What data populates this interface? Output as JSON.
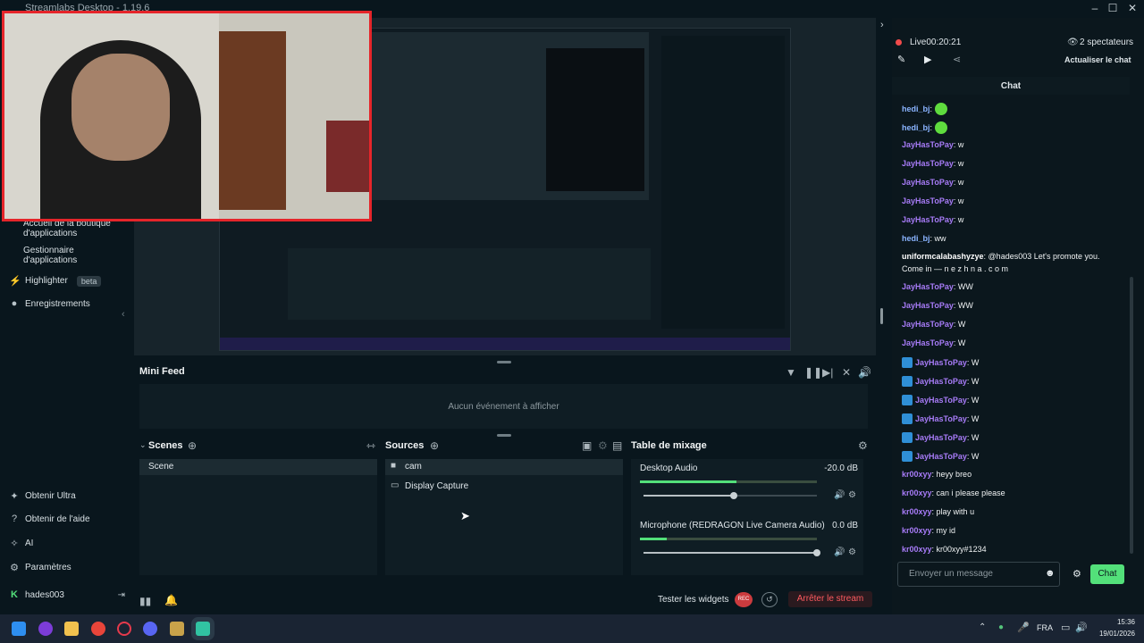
{
  "window": {
    "title": "Streamlabs Desktop - 1.19.6",
    "controls": [
      "–",
      "☐",
      "✕"
    ]
  },
  "sidebar": {
    "items": [
      {
        "label": "Accueil de la boutique d'applications",
        "icon": "store-icon"
      },
      {
        "label": "Gestionnaire d'applications",
        "icon": "apps-icon"
      },
      {
        "label": "Highlighter",
        "badge": "beta",
        "icon": "highlighter-icon"
      },
      {
        "label": "Enregistrements",
        "icon": "recordings-icon"
      }
    ],
    "bottom": [
      {
        "label": "Obtenir Ultra",
        "icon": "ultra-icon"
      },
      {
        "label": "Obtenir de l'aide",
        "icon": "help-icon"
      },
      {
        "label": "AI",
        "icon": "ai-icon"
      },
      {
        "label": "Paramètres",
        "icon": "gear-icon"
      }
    ],
    "user": "hades003"
  },
  "minifeed": {
    "title": "Mini Feed",
    "empty": "Aucun événement à afficher"
  },
  "scenes": {
    "title": "Scenes",
    "items": [
      "Scene"
    ]
  },
  "sources": {
    "title": "Sources",
    "items": [
      "cam",
      "Display Capture"
    ]
  },
  "mixer": {
    "title": "Table de mixage",
    "channels": [
      {
        "name": "Desktop Audio",
        "db": "-20.0 dB",
        "level": 0.52
      },
      {
        "name": "Microphone (REDRAGON Live Camera Audio)",
        "db": "0.0 dB",
        "level": 1.0
      }
    ]
  },
  "footer": {
    "test_widgets": "Tester les widgets",
    "rec": "REC",
    "stop": "Arrêter le stream"
  },
  "chat": {
    "status": "Live00:20:21",
    "viewers": "2 spectateurs",
    "refresh": "Actualiser le chat",
    "title": "Chat",
    "messages": [
      {
        "user": "hedi_bj",
        "text": "",
        "emote": true,
        "color": "blue"
      },
      {
        "user": "hedi_bj",
        "text": "",
        "emote": true,
        "color": "blue"
      },
      {
        "user": "JayHasToPay",
        "text": ": w"
      },
      {
        "user": "JayHasToPay",
        "text": ": w"
      },
      {
        "user": "JayHasToPay",
        "text": ": w"
      },
      {
        "user": "JayHasToPay",
        "text": ": w"
      },
      {
        "user": "JayHasToPay",
        "text": ": w"
      },
      {
        "user": "hedi_bj",
        "text": ": ww",
        "color": "blue"
      },
      {
        "user": "uniformcalabashyzye",
        "text": ": @hades003 Let's promote you.",
        "text2": "Come in — n e z h n a . c o m",
        "color": "white"
      },
      {
        "user": "JayHasToPay",
        "text": ": WW"
      },
      {
        "user": "JayHasToPay",
        "text": ": WW"
      },
      {
        "user": "JayHasToPay",
        "text": ": W"
      },
      {
        "user": "JayHasToPay",
        "text": ": W"
      },
      {
        "user": "JayHasToPay",
        "text": ": W",
        "sub": true
      },
      {
        "user": "JayHasToPay",
        "text": ": W",
        "sub": true
      },
      {
        "user": "JayHasToPay",
        "text": ": W",
        "sub": true
      },
      {
        "user": "JayHasToPay",
        "text": ": W",
        "sub": true
      },
      {
        "user": "JayHasToPay",
        "text": ": W",
        "sub": true
      },
      {
        "user": "JayHasToPay",
        "text": ": W",
        "sub": true
      },
      {
        "user": "kr00xyy",
        "text": ": heyy breo"
      },
      {
        "user": "kr00xyy",
        "text": ": can i please please"
      },
      {
        "user": "kr00xyy",
        "text": ": play with u"
      },
      {
        "user": "kr00xyy",
        "text": ": my id"
      },
      {
        "user": "kr00xyy",
        "text": ": kr00xyy#1234"
      }
    ],
    "input_placeholder": "Envoyer un message",
    "send": "Chat"
  },
  "taskbar": {
    "lang": "FRA",
    "time": "15:36",
    "date": "19/01/2026"
  }
}
